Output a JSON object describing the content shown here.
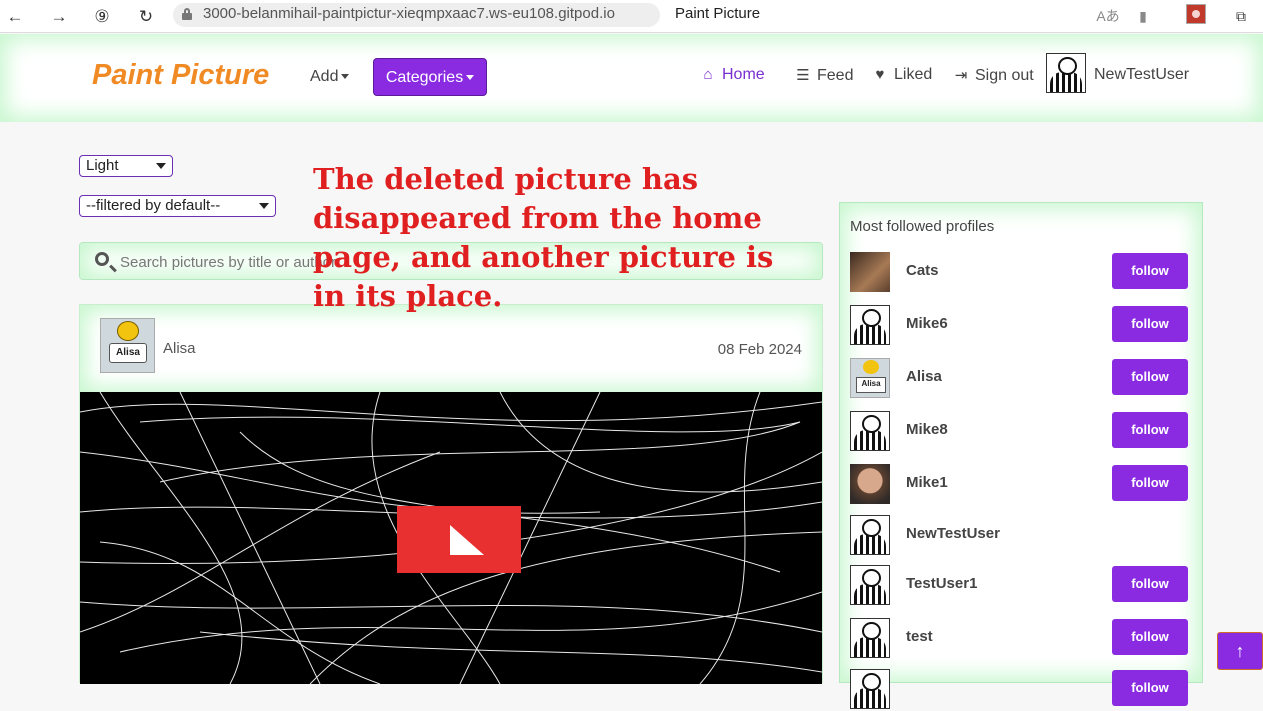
{
  "browser": {
    "url": "3000-belanmihail-paintpictur-xieqmpxaac7.ws-eu108.gitpod.io",
    "tab_title": "Paint Picture"
  },
  "header": {
    "brand": "Paint Picture",
    "add_label": "Add",
    "categories_label": "Categories",
    "nav": [
      {
        "label": "Home",
        "icon": "home-icon",
        "active": true
      },
      {
        "label": "Feed",
        "icon": "list-icon",
        "active": false
      },
      {
        "label": "Liked",
        "icon": "heart-icon",
        "active": false
      },
      {
        "label": "Sign out",
        "icon": "sign-out-icon",
        "active": false
      }
    ],
    "username": "NewTestUser"
  },
  "controls": {
    "theme_select": "Light",
    "filter_select": "--filtered by default--",
    "search_placeholder": "Search pictures by title or author"
  },
  "annotation": "The deleted picture has disappeared from the home page, and another picture is in its place.",
  "post": {
    "author": "Alisa",
    "avatar_badge": "Alisa",
    "date": "08 Feb 2024"
  },
  "sidebar": {
    "title": "Most followed profiles",
    "follow_label": "follow",
    "profiles": [
      {
        "name": "Cats",
        "avatar": "photo-cats",
        "follow": true
      },
      {
        "name": "Mike6",
        "avatar": "default",
        "follow": true
      },
      {
        "name": "Alisa",
        "avatar": "alisa",
        "follow": true
      },
      {
        "name": "Mike8",
        "avatar": "default",
        "follow": true
      },
      {
        "name": "Mike1",
        "avatar": "photo-mike1",
        "follow": true
      },
      {
        "name": "NewTestUser",
        "avatar": "default",
        "follow": false
      },
      {
        "name": "TestUser1",
        "avatar": "default",
        "follow": true
      },
      {
        "name": "test",
        "avatar": "default",
        "follow": true
      },
      {
        "name": "",
        "avatar": "default",
        "follow": true
      }
    ]
  },
  "scroll_top_icon": "arrow-up-icon"
}
